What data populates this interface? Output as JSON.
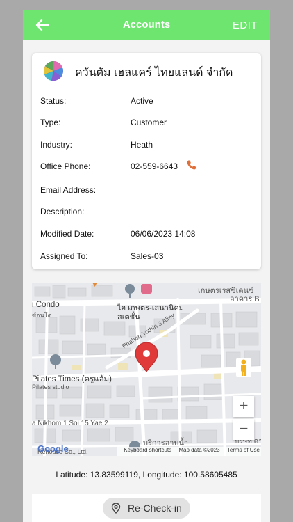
{
  "header": {
    "title": "Accounts",
    "edit_label": "EDIT"
  },
  "account": {
    "company": "ควันตัม เฮลแคร์ ไทยแลนด์ จำกัด",
    "fields": [
      {
        "label": "Status:",
        "value": "Active"
      },
      {
        "label": "Type:",
        "value": "Customer"
      },
      {
        "label": "Industry:",
        "value": "Heath"
      },
      {
        "label": "Office Phone:",
        "value": "02-559-6643"
      },
      {
        "label": "Email Address:",
        "value": ""
      },
      {
        "label": "Description:",
        "value": ""
      },
      {
        "label": "Modified Date:",
        "value": "06/06/2023 14:08"
      },
      {
        "label": "Assigned To:",
        "value": "Sales-03"
      }
    ]
  },
  "map": {
    "labels": {
      "condo": "i Condo",
      "condo_th": "ซ์อนโด",
      "kaset": "เกษตรเรสซิเดนซ์",
      "kaset2": "อาคาร B",
      "sai1": "ไฮ เกษตร-เสนานิคม",
      "sai2": "สเตชั่น",
      "alley": "Phahon Yothin 3 Alley",
      "pilates": "Pilates Times (ครูแอ้ม)",
      "pilates_sub": "Pilates studio",
      "nikhom": "a Nikhom 1 Soi 15 Yae 2",
      "service": "บริการอาบน้ำ",
      "house": "Rehouse Co., Ltd.",
      "road": "บริษัท ดารา"
    },
    "google": "Google",
    "attribution": {
      "shortcuts": "Keyboard shortcuts",
      "data": "Map data ©2023",
      "terms": "Terms of Use"
    },
    "zoom_in": "+",
    "zoom_out": "−"
  },
  "location": {
    "text": "Latitude: 13.83599119, Longitude: 100.58605485"
  },
  "checkin": {
    "label": "Re-Check-in"
  },
  "colors": {
    "appbar": "#6ee56e",
    "phone_icon": "#e0703a",
    "pin": "#e03a3a"
  }
}
